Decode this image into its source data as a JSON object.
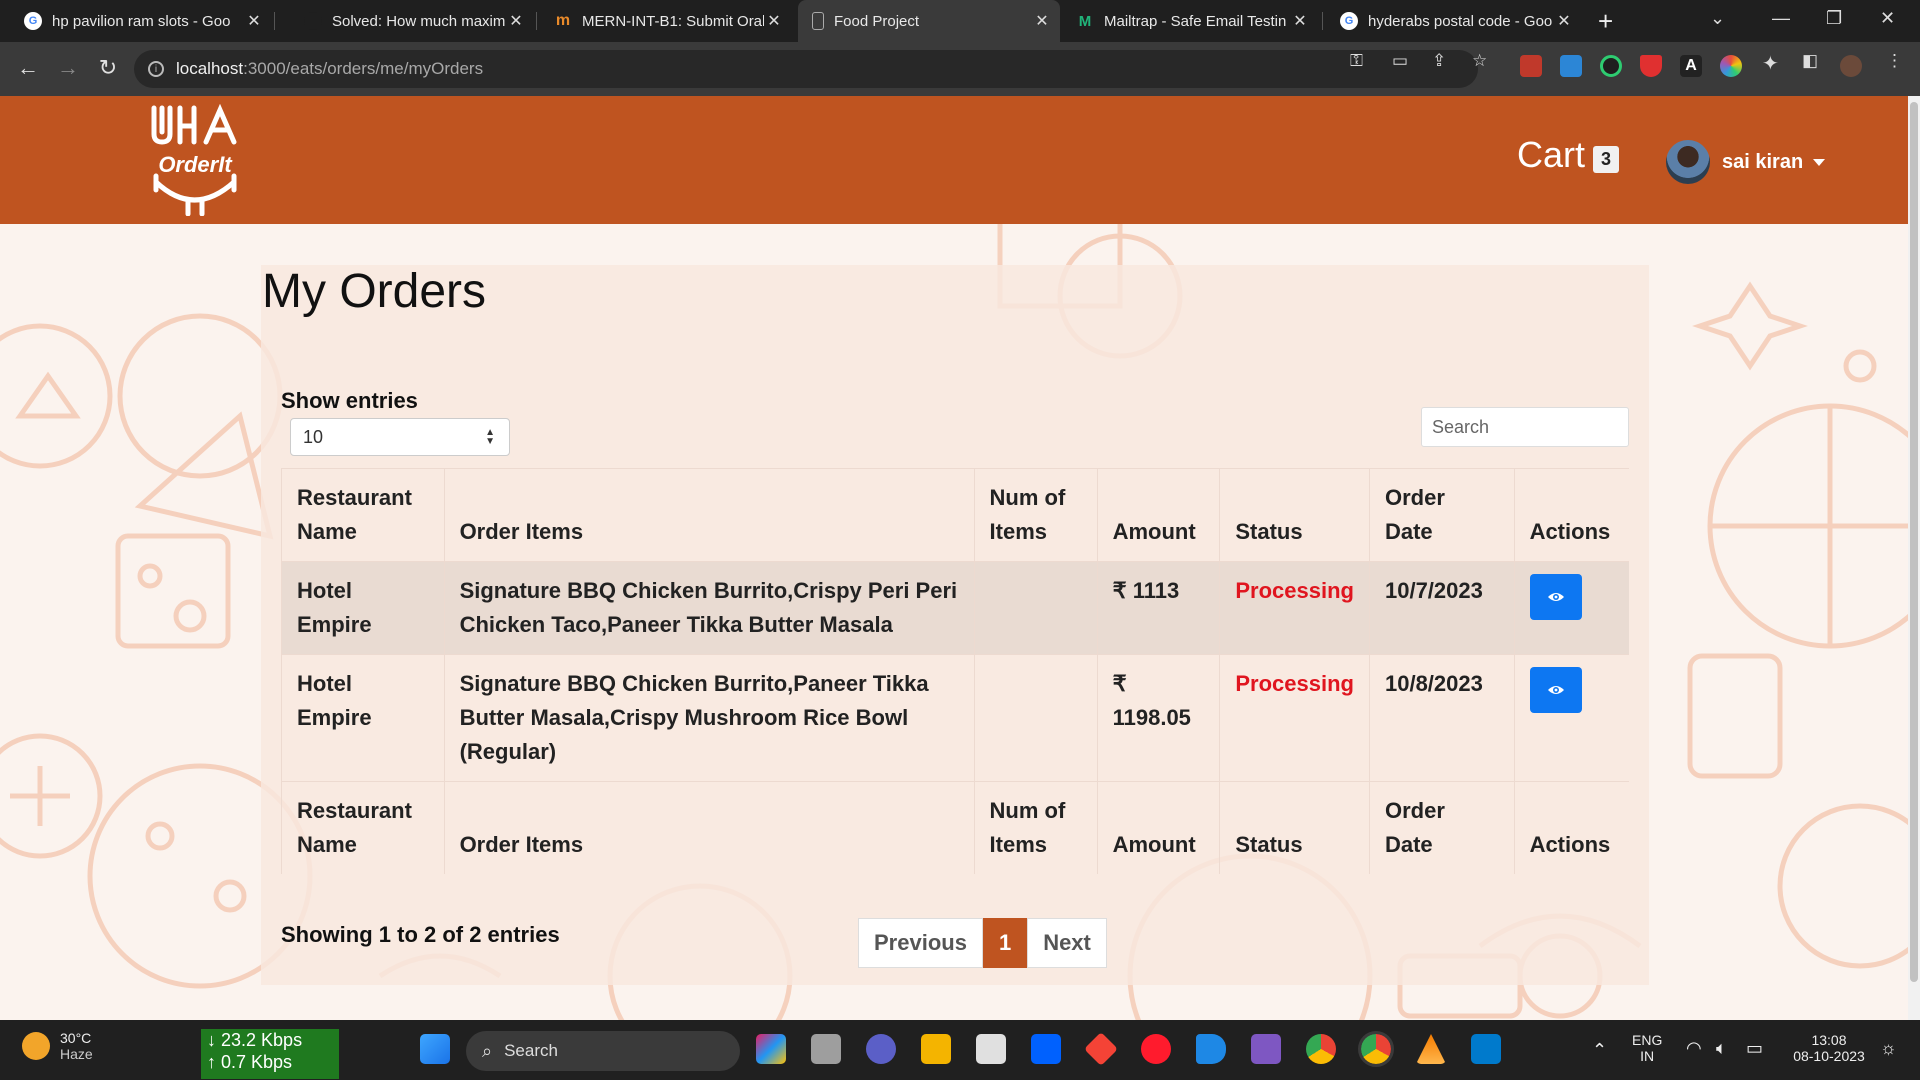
{
  "browser": {
    "tabs": [
      {
        "title": "hp pavilion ram slots - Goo",
        "fav_color": "#ffffff",
        "fav_glyph": "G"
      },
      {
        "title": "Solved: How much maximu",
        "fav_color": "#1f1f1f",
        "fav_glyph": ""
      },
      {
        "title": "MERN-INT-B1: Submit Oral",
        "fav_color": "#e98a2a",
        "fav_glyph": "m"
      },
      {
        "title": "Food Project",
        "fav_color": "#3a3a3a",
        "fav_glyph": ""
      },
      {
        "title": "Mailtrap - Safe Email Testin",
        "fav_color": "#21b47a",
        "fav_glyph": "M"
      },
      {
        "title": "hyderabs postal code - Goo",
        "fav_color": "#ffffff",
        "fav_glyph": "G"
      }
    ],
    "url_host": "localhost",
    "url_path": ":3000/eats/orders/me/myOrders"
  },
  "header": {
    "logo_text": "OrderIt",
    "cart_label": "Cart",
    "cart_count": "3",
    "user_name": "sai kiran"
  },
  "main": {
    "title": "My Orders",
    "show_entries_label": "Show entries",
    "entries_value": "10",
    "search_placeholder": "Search",
    "columns": [
      "Restaurant Name",
      "Order Items",
      "Num of Items",
      "Amount",
      "Status",
      "Order Date",
      "Actions"
    ],
    "rows": [
      {
        "restaurant": "Hotel Empire",
        "items": "Signature BBQ Chicken Burrito,Crispy Peri Peri Chicken Taco,Paneer Tikka Butter Masala",
        "num_items": "",
        "amount": "₹ 1113",
        "status": "Processing",
        "date": "10/7/2023"
      },
      {
        "restaurant": "Hotel Empire",
        "items": "Signature BBQ Chicken Burrito,Paneer Tikka Butter Masala,Crispy Mushroom Rice Bowl (Regular)",
        "num_items": "",
        "amount": "₹ 1198.05",
        "status": "Processing",
        "date": "10/8/2023"
      }
    ],
    "showing_text": "Showing 1 to 2 of 2 entries",
    "pager": {
      "previous": "Previous",
      "current": "1",
      "next": "Next"
    }
  },
  "colors": {
    "brand": "#bf5420",
    "status_processing": "#e0151f",
    "action_button": "#0d77f2"
  },
  "taskbar": {
    "temperature": "30°C",
    "weather": "Haze",
    "download_speed": "↓ 23.2 Kbps",
    "upload_speed": "↑ 0.7 Kbps",
    "search_label": "Search",
    "language_1": "ENG",
    "language_2": "IN",
    "time": "13:08",
    "date": "08-10-2023"
  }
}
